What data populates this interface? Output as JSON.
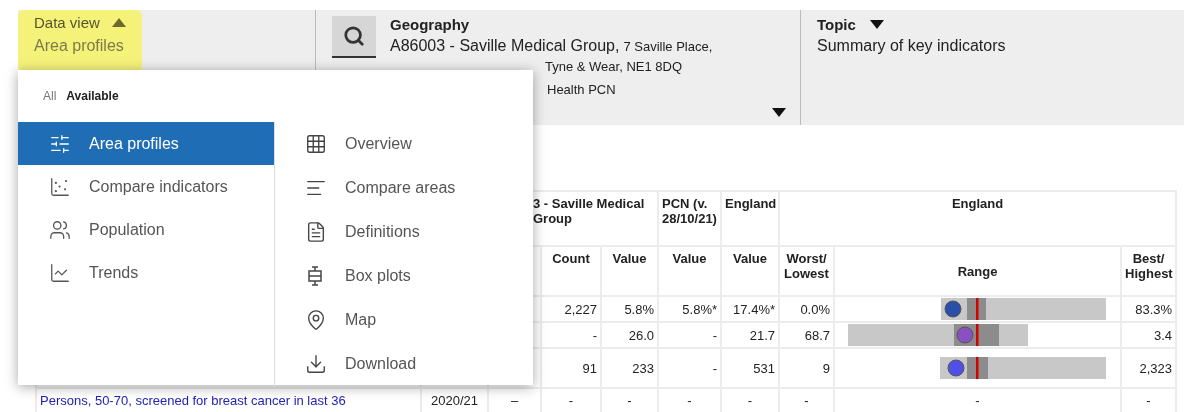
{
  "data_view": {
    "label": "Data view",
    "expanded": true,
    "value": "Area profiles"
  },
  "geography": {
    "label": "Geography",
    "name": "A86003 - Saville Medical Group,",
    "address_1": "7 Saville Place,",
    "address_2": "Tyne & Wear, NE1 8DQ",
    "pcn": "Health PCN"
  },
  "topic": {
    "label": "Topic",
    "value": "Summary of key indicators"
  },
  "menu": {
    "tabs": [
      {
        "label": "All",
        "selected": false
      },
      {
        "label": "Available",
        "selected": true
      }
    ],
    "items": [
      {
        "label": "Area profiles",
        "selected": true
      },
      {
        "label": "Compare indicators",
        "selected": false
      },
      {
        "label": "Population",
        "selected": false
      },
      {
        "label": "Trends",
        "selected": false
      }
    ],
    "more_items": [
      {
        "label": "Overview",
        "selected": false
      },
      {
        "label": "Compare areas",
        "selected": false
      },
      {
        "label": "Definitions",
        "selected": false
      },
      {
        "label": "Box plots",
        "selected": false
      },
      {
        "label": "Map",
        "selected": false
      },
      {
        "label": "Download",
        "selected": false
      }
    ]
  },
  "table": {
    "group_headers": [
      "3 - Saville Medical Group",
      "PCN (v. 28/10/21)",
      "England",
      "England"
    ],
    "columns": [
      "Count",
      "Value",
      "Value",
      "Value",
      "Worst/ Lowest",
      "Range",
      "Best/ Highest"
    ],
    "rows": [
      {
        "cells": [
          "2,227",
          "5.8%",
          "5.8%*",
          "17.4%*",
          "0.0%"
        ],
        "color": "#2a4fa8",
        "best": "83.3%"
      },
      {
        "cells": [
          "-",
          "26.0",
          "-",
          "21.7",
          "68.7"
        ],
        "color": "#8a4fc0",
        "best": "3.4"
      },
      {
        "cells": [
          "91",
          "233",
          "-",
          "531",
          "9"
        ],
        "color": "#5050e8",
        "best": "2,323"
      },
      {
        "indicator": "Persons, 50-70, screened for breast cancer in last 36",
        "period": "2020/21",
        "marker": "–",
        "cells": [
          "-",
          "-",
          "-",
          "-",
          "-"
        ],
        "range": "-",
        "best": "-"
      }
    ]
  }
}
